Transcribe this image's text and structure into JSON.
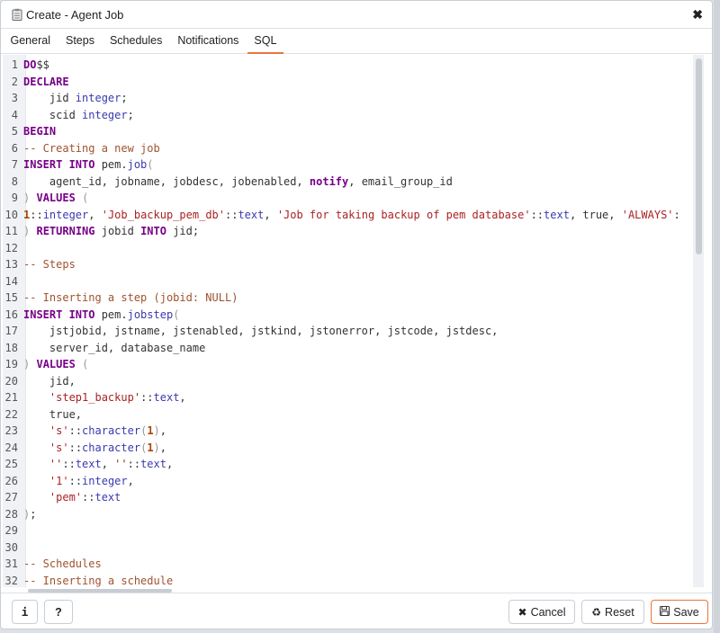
{
  "dialog": {
    "title": "Create - Agent Job",
    "title_icon": "clipboard-icon",
    "close_icon": "close-icon"
  },
  "tabs": [
    {
      "label": "General",
      "active": false
    },
    {
      "label": "Steps",
      "active": false
    },
    {
      "label": "Schedules",
      "active": false
    },
    {
      "label": "Notifications",
      "active": false
    },
    {
      "label": "SQL",
      "active": true
    }
  ],
  "colors": {
    "accent": "#e8763b",
    "keyword": "#770088",
    "type": "#3a3ab0",
    "string": "#aa2222",
    "comment": "#a0522d"
  },
  "editor": {
    "lines": [
      [
        [
          "kw",
          "DO"
        ],
        [
          "",
          "$$"
        ]
      ],
      [
        [
          "kw",
          "DECLARE"
        ]
      ],
      [
        [
          "",
          "    jid "
        ],
        [
          "ty",
          "integer"
        ],
        [
          "",
          ";"
        ]
      ],
      [
        [
          "",
          "    scid "
        ],
        [
          "ty",
          "integer"
        ],
        [
          "",
          ";"
        ]
      ],
      [
        [
          "kw",
          "BEGIN"
        ]
      ],
      [
        [
          "cm",
          "-- Creating a new job"
        ]
      ],
      [
        [
          "kw",
          "INSERT INTO"
        ],
        [
          "",
          " pem."
        ],
        [
          "ty",
          "job"
        ],
        [
          "punc",
          "("
        ]
      ],
      [
        [
          "",
          "    agent_id, jobname, jobdesc, jobenabled, "
        ],
        [
          "kw",
          "notify"
        ],
        [
          "",
          ", email_group_id"
        ]
      ],
      [
        [
          "punc",
          ")"
        ],
        [
          "",
          " "
        ],
        [
          "kw",
          "VALUES"
        ],
        [
          "",
          " "
        ],
        [
          "punc",
          "("
        ]
      ],
      [
        [
          "num",
          "1"
        ],
        [
          "",
          "::"
        ],
        [
          "ty",
          "integer"
        ],
        [
          "",
          ", "
        ],
        [
          "str",
          "'Job_backup_pem_db'"
        ],
        [
          "",
          "::"
        ],
        [
          "ty",
          "text"
        ],
        [
          "",
          ", "
        ],
        [
          "str",
          "'Job for taking backup of pem database'"
        ],
        [
          "",
          "::"
        ],
        [
          "ty",
          "text"
        ],
        [
          "",
          ", true, "
        ],
        [
          "str",
          "'ALWAYS'"
        ],
        [
          "",
          ":"
        ]
      ],
      [
        [
          "punc",
          ")"
        ],
        [
          "",
          " "
        ],
        [
          "kw",
          "RETURNING"
        ],
        [
          "",
          " jobid "
        ],
        [
          "kw",
          "INTO"
        ],
        [
          "",
          " jid;"
        ]
      ],
      [
        [
          "",
          ""
        ]
      ],
      [
        [
          "cm",
          "-- Steps"
        ]
      ],
      [
        [
          "",
          ""
        ]
      ],
      [
        [
          "cm",
          "-- Inserting a step (jobid: NULL)"
        ]
      ],
      [
        [
          "kw",
          "INSERT INTO"
        ],
        [
          "",
          " pem."
        ],
        [
          "ty",
          "jobstep"
        ],
        [
          "punc",
          "("
        ]
      ],
      [
        [
          "",
          "    jstjobid, jstname, jstenabled, jstkind, jstonerror, jstcode, jstdesc,"
        ]
      ],
      [
        [
          "",
          "    server_id, database_name"
        ]
      ],
      [
        [
          "punc",
          ")"
        ],
        [
          "",
          " "
        ],
        [
          "kw",
          "VALUES"
        ],
        [
          "",
          " "
        ],
        [
          "punc",
          "("
        ]
      ],
      [
        [
          "",
          "    jid,"
        ]
      ],
      [
        [
          "",
          "    "
        ],
        [
          "str",
          "'step1_backup'"
        ],
        [
          "",
          "::"
        ],
        [
          "ty",
          "text"
        ],
        [
          "",
          ","
        ]
      ],
      [
        [
          "",
          "    true,"
        ]
      ],
      [
        [
          "",
          "    "
        ],
        [
          "str",
          "'s'"
        ],
        [
          "",
          "::"
        ],
        [
          "ty",
          "character"
        ],
        [
          "punc",
          "("
        ],
        [
          "num",
          "1"
        ],
        [
          "punc",
          ")"
        ],
        [
          "",
          ","
        ]
      ],
      [
        [
          "",
          "    "
        ],
        [
          "str",
          "'s'"
        ],
        [
          "",
          "::"
        ],
        [
          "ty",
          "character"
        ],
        [
          "punc",
          "("
        ],
        [
          "num",
          "1"
        ],
        [
          "punc",
          ")"
        ],
        [
          "",
          ","
        ]
      ],
      [
        [
          "",
          "    "
        ],
        [
          "str",
          "''"
        ],
        [
          "",
          "::"
        ],
        [
          "ty",
          "text"
        ],
        [
          "",
          ", "
        ],
        [
          "str",
          "''"
        ],
        [
          "",
          "::"
        ],
        [
          "ty",
          "text"
        ],
        [
          "",
          ","
        ]
      ],
      [
        [
          "",
          "    "
        ],
        [
          "str",
          "'1'"
        ],
        [
          "",
          "::"
        ],
        [
          "ty",
          "integer"
        ],
        [
          "",
          ","
        ]
      ],
      [
        [
          "",
          "    "
        ],
        [
          "str",
          "'pem'"
        ],
        [
          "",
          "::"
        ],
        [
          "ty",
          "text"
        ]
      ],
      [
        [
          "punc",
          ")"
        ],
        [
          "",
          ";"
        ]
      ],
      [
        [
          "",
          ""
        ]
      ],
      [
        [
          "",
          ""
        ]
      ],
      [
        [
          "cm",
          "-- Schedules"
        ]
      ],
      [
        [
          "cm",
          "-- Inserting a schedule"
        ]
      ]
    ]
  },
  "footer": {
    "info_label": "i",
    "help_label": "?",
    "cancel_label": "Cancel",
    "reset_label": "Reset",
    "save_label": "Save",
    "cancel_icon": "✖",
    "reset_icon": "♻",
    "save_icon": "🖫"
  }
}
